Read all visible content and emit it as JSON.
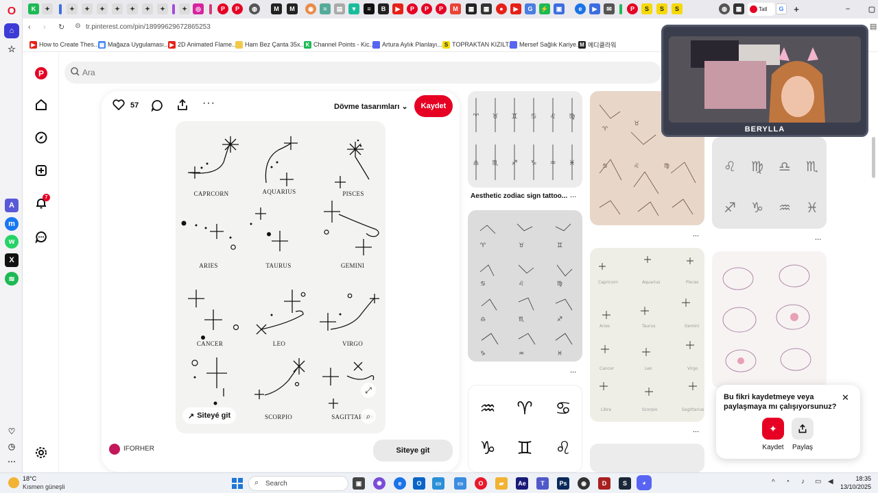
{
  "browser": {
    "url": "tr.pinterest.com/pin/18999629672865253",
    "tabs_visible_title": "Tatl",
    "bookmarks": [
      {
        "label": "How to Create Thes...",
        "color": "#e62117"
      },
      {
        "label": "Mağaza Uygulaması...",
        "color": "#4285f4"
      },
      {
        "label": "2D Animated Flame...",
        "color": "#e62117"
      },
      {
        "label": "Ham Bez Çanta 35x...",
        "color": "#f2c94c"
      },
      {
        "label": "Channel Points - Kic...",
        "color": "#1db954"
      },
      {
        "label": "Artura Aylık Planlayı...",
        "color": "#5865f2"
      },
      {
        "label": "TOPRAKTAN KIZILT...",
        "color": "#f5d90a"
      },
      {
        "label": "Mersef Sağlık Kariye...",
        "color": "#5865f2"
      },
      {
        "label": "메디클라워",
        "color": "#222222"
      }
    ]
  },
  "sidebar": {
    "notification_count": "7"
  },
  "search": {
    "placeholder": "Ara"
  },
  "pin": {
    "likes": "57",
    "board": "Dövme tasarımları",
    "save_label": "Kaydet",
    "site_label_overlay": "Siteyé git",
    "site_button": "Siteye git",
    "author": "IFORHER",
    "zodiac": [
      "CAPRCORN",
      "AQUARIUS",
      "PISCES",
      "ARIES",
      "TAURUS",
      "GEMINI",
      "CANCER",
      "LEO",
      "VIRGO",
      "SCORPIO",
      "SAGITTARIUS"
    ]
  },
  "feed": {
    "caption_1": "Aesthetic zodiac sign tattoo...",
    "more": "..."
  },
  "popup": {
    "title": "Bu fikri kaydetmeye veya paylaşmaya mı çalışıyorsunuz?",
    "save_label": "Kaydet",
    "share_label": "Paylaş"
  },
  "webcam": {
    "name": "BERYLLA"
  },
  "taskbar": {
    "weather_temp": "18°C",
    "weather_desc": "Kısmen güneşli",
    "search": "Search",
    "time": "18:35",
    "date": "13/10/2025"
  },
  "colors": {
    "pinterest_red": "#e60023",
    "taskbar_bg": "#eef1f6"
  }
}
